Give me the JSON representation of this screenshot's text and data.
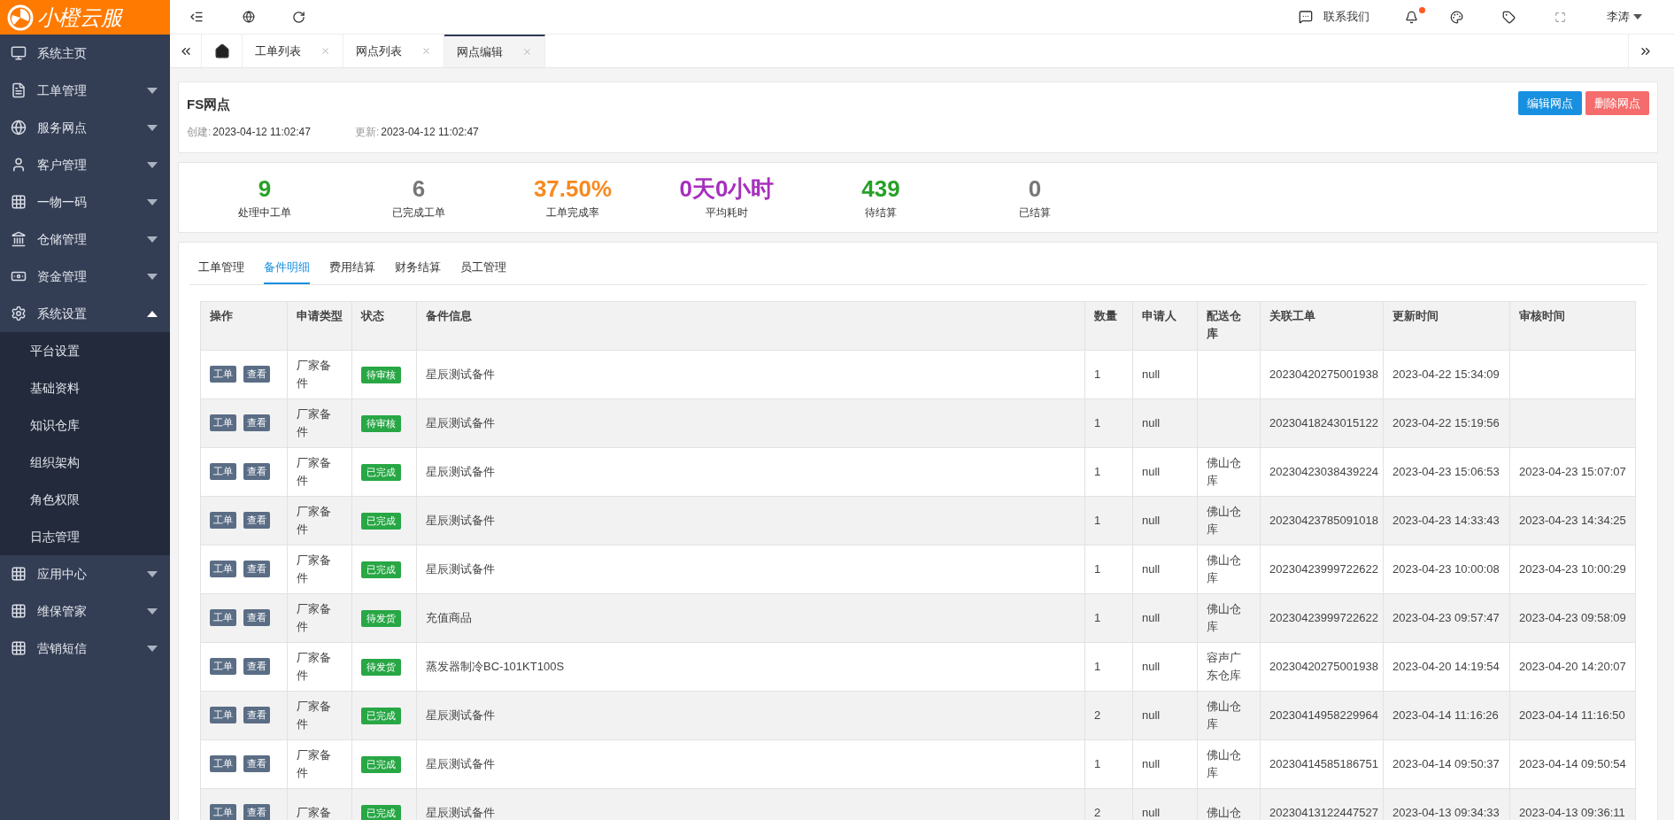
{
  "logo": {
    "text": "小橙云服"
  },
  "sidebar": {
    "items": [
      {
        "label": "系统主页",
        "kind": "link"
      },
      {
        "label": "工单管理",
        "kind": "menu",
        "expanded": false
      },
      {
        "label": "服务网点",
        "kind": "menu",
        "expanded": false
      },
      {
        "label": "客户管理",
        "kind": "menu",
        "expanded": false
      },
      {
        "label": "一物一码",
        "kind": "menu",
        "expanded": false
      },
      {
        "label": "仓储管理",
        "kind": "menu",
        "expanded": false
      },
      {
        "label": "资金管理",
        "kind": "menu",
        "expanded": false
      },
      {
        "label": "系统设置",
        "kind": "menu",
        "expanded": true,
        "children": [
          {
            "label": "平台设置"
          },
          {
            "label": "基础资料"
          },
          {
            "label": "知识仓库"
          },
          {
            "label": "组织架构"
          },
          {
            "label": "角色权限"
          },
          {
            "label": "日志管理"
          }
        ]
      },
      {
        "label": "应用中心",
        "kind": "menu",
        "expanded": false
      },
      {
        "label": "维保管家",
        "kind": "menu",
        "expanded": false
      },
      {
        "label": "营销短信",
        "kind": "menu",
        "expanded": false
      }
    ]
  },
  "topbar": {
    "contact": "联系我们",
    "notification_dot": true,
    "user": "李涛"
  },
  "page_tabs": [
    {
      "label": "工单列表",
      "selected": false
    },
    {
      "label": "网点列表",
      "selected": false
    },
    {
      "label": "网点编辑",
      "selected": true
    }
  ],
  "header": {
    "title": "FS网点",
    "created_label": "创建:",
    "created": "2023-04-12 11:02:47",
    "updated_label": "更新:",
    "updated": "2023-04-12 11:02:47",
    "buttons": [
      {
        "label": "编辑网点",
        "color": "#1890e0"
      },
      {
        "label": "删除网点",
        "color": "#f56c6c"
      }
    ]
  },
  "stats": [
    {
      "value": "9",
      "label": "处理中工单",
      "color": "#27a127"
    },
    {
      "value": "6",
      "label": "已完成工单",
      "color": "#777777"
    },
    {
      "value": "37.50%",
      "label": "工单完成率",
      "color": "#f7891f"
    },
    {
      "value": "0天0小时",
      "label": "平均耗时",
      "color": "#a62fbd"
    },
    {
      "value": "439",
      "label": "待结算",
      "color": "#27a127"
    },
    {
      "value": "0",
      "label": "已结算",
      "color": "#777777"
    }
  ],
  "detail_tabs": [
    {
      "label": "工单管理",
      "selected": false
    },
    {
      "label": "备件明细",
      "selected": true
    },
    {
      "label": "费用结算",
      "selected": false
    },
    {
      "label": "财务结算",
      "selected": false
    },
    {
      "label": "员工管理",
      "selected": false
    }
  ],
  "table": {
    "columns": [
      "操作",
      "申请类型",
      "状态",
      "备件信息",
      "数量",
      "申请人",
      "配送仓库",
      "关联工单",
      "更新时间",
      "审核时间"
    ],
    "rows": [
      {
        "actions": [
          "工单",
          "查看"
        ],
        "type": "厂家备件",
        "status": "待审核",
        "info": "星辰测试备件",
        "qty": "1",
        "applicant": "null",
        "warehouse": "",
        "order": "20230420275001938",
        "updated": "2023-04-22 15:34:09",
        "reviewed": ""
      },
      {
        "actions": [
          "工单",
          "查看"
        ],
        "type": "厂家备件",
        "status": "待审核",
        "info": "星辰测试备件",
        "qty": "1",
        "applicant": "null",
        "warehouse": "",
        "order": "20230418243015122",
        "updated": "2023-04-22 15:19:56",
        "reviewed": ""
      },
      {
        "actions": [
          "工单",
          "查看"
        ],
        "type": "厂家备件",
        "status": "已完成",
        "info": "星辰测试备件",
        "qty": "1",
        "applicant": "null",
        "warehouse": "佛山仓库",
        "order": "20230423038439224",
        "updated": "2023-04-23 15:06:53",
        "reviewed": "2023-04-23 15:07:07"
      },
      {
        "actions": [
          "工单",
          "查看"
        ],
        "type": "厂家备件",
        "status": "已完成",
        "info": "星辰测试备件",
        "qty": "1",
        "applicant": "null",
        "warehouse": "佛山仓库",
        "order": "20230423785091018",
        "updated": "2023-04-23 14:33:43",
        "reviewed": "2023-04-23 14:34:25"
      },
      {
        "actions": [
          "工单",
          "查看"
        ],
        "type": "厂家备件",
        "status": "已完成",
        "info": "星辰测试备件",
        "qty": "1",
        "applicant": "null",
        "warehouse": "佛山仓库",
        "order": "20230423999722622",
        "updated": "2023-04-23 10:00:08",
        "reviewed": "2023-04-23 10:00:29"
      },
      {
        "actions": [
          "工单",
          "查看"
        ],
        "type": "厂家备件",
        "status": "待发货",
        "info": "充值商品",
        "qty": "1",
        "applicant": "null",
        "warehouse": "佛山仓库",
        "order": "20230423999722622",
        "updated": "2023-04-23 09:57:47",
        "reviewed": "2023-04-23 09:58:09"
      },
      {
        "actions": [
          "工单",
          "查看"
        ],
        "type": "厂家备件",
        "status": "待发货",
        "info": "蒸发器制冷BC-101KT100S",
        "qty": "1",
        "applicant": "null",
        "warehouse": "容声广东仓库",
        "order": "20230420275001938",
        "updated": "2023-04-20 14:19:54",
        "reviewed": "2023-04-20 14:20:07"
      },
      {
        "actions": [
          "工单",
          "查看"
        ],
        "type": "厂家备件",
        "status": "已完成",
        "info": "星辰测试备件",
        "qty": "2",
        "applicant": "null",
        "warehouse": "佛山仓库",
        "order": "20230414958229964",
        "updated": "2023-04-14 11:16:26",
        "reviewed": "2023-04-14 11:16:50"
      },
      {
        "actions": [
          "工单",
          "查看"
        ],
        "type": "厂家备件",
        "status": "已完成",
        "info": "星辰测试备件",
        "qty": "1",
        "applicant": "null",
        "warehouse": "佛山仓库",
        "order": "20230414585186751",
        "updated": "2023-04-14 09:50:37",
        "reviewed": "2023-04-14 09:50:54"
      },
      {
        "actions": [
          "工单",
          "查看"
        ],
        "type": "厂家备",
        "status": "已完成",
        "info": "星辰测试备件",
        "qty": "2",
        "applicant": "null",
        "warehouse": "佛山仓",
        "order": "20230413122447527",
        "updated": "2023-04-13 09:34:33",
        "reviewed": "2023-04-13 09:36:11"
      }
    ]
  }
}
